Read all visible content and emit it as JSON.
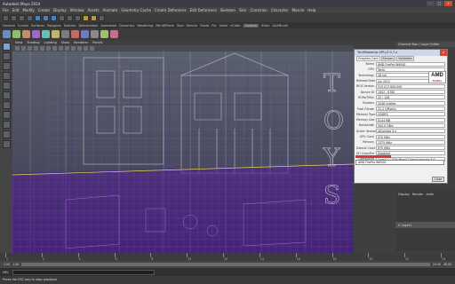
{
  "window": {
    "title": "Autodesk Maya 2014",
    "buttons": [
      "–",
      "□",
      "×"
    ]
  },
  "menubar": [
    "File",
    "Edit",
    "Modify",
    "Create",
    "Display",
    "Window",
    "Assets",
    "Animate",
    "Geometry Cache",
    "Create Deformers",
    "Edit Deformers",
    "Skeleton",
    "Skin",
    "Constrain",
    "Character",
    "Muscle",
    "Help"
  ],
  "shelf_tabs": [
    "General",
    "Curves",
    "Surfaces",
    "Polygons",
    "Subdivs",
    "Deformation",
    "Animation",
    "Dynamics",
    "Rendering",
    "PaintEffects",
    "Toon",
    "Muscle",
    "Fluids",
    "Fur",
    "nHair",
    "nCloth",
    "Custom",
    "XGen",
    "GoZBrush"
  ],
  "shelf_active_tab": "Custom",
  "viewport_menu": [
    "View",
    "Shading",
    "Lighting",
    "Show",
    "Renderer",
    "Panels"
  ],
  "channel_box": {
    "header": "Channel Box / Layer Editor"
  },
  "dialog": {
    "title": "TechPowerUp GPU-Z 0.7.x",
    "close": "×",
    "tabs": [
      "Graphics Card",
      "Sensors",
      "Validation"
    ],
    "rows": [
      {
        "label": "Name",
        "value": "AMD FirePro W9000"
      },
      {
        "label": "GPU",
        "value": "Tahiti"
      },
      {
        "label": "Technology",
        "value": "28 nm"
      },
      {
        "label": "Release Date",
        "value": "Jun 2012"
      },
      {
        "label": "BIOS Version",
        "value": "015.017.000.000"
      },
      {
        "label": "Device ID",
        "value": "1002 - 6780"
      },
      {
        "label": "ROPs/TMUs",
        "value": "32 / 128"
      },
      {
        "label": "Shaders",
        "value": "2048 Unified"
      },
      {
        "label": "Pixel Fillrate",
        "value": "31.2 GPixel/s"
      },
      {
        "label": "Memory Type",
        "value": "GDDR5"
      },
      {
        "label": "Memory Size",
        "value": "6144 MB"
      },
      {
        "label": "Bandwidth",
        "value": "264.0 GB/s"
      },
      {
        "label": "Driver Version",
        "value": "atiumdag 9.x"
      },
      {
        "label": "GPU Clock",
        "value": "975 MHz"
      },
      {
        "label": "Memory",
        "value": "1375 MHz"
      },
      {
        "label": "Default Clock",
        "value": "975 MHz"
      },
      {
        "label": "ATI CrossFire",
        "value": "Disabled"
      },
      {
        "label": "Computing",
        "value": "OpenCL  CUDA  PhysX  DirectCompute 5.0"
      }
    ],
    "brand": "AMD",
    "brand_sub": "FirePro",
    "selector": "AMD FirePro W9000",
    "close_button": "Close"
  },
  "timeline": {
    "ticks": [
      "1",
      "2",
      "4",
      "6",
      "8",
      "10",
      "12",
      "14",
      "16",
      "18",
      "20",
      "22",
      "24"
    ],
    "range_start": "1.00",
    "range_end": "24.00",
    "anim_start": "1.00",
    "anim_end": "48.00"
  },
  "command_line": {
    "label": "MEL"
  },
  "help_line": "Press the ESC key to stop playback"
}
